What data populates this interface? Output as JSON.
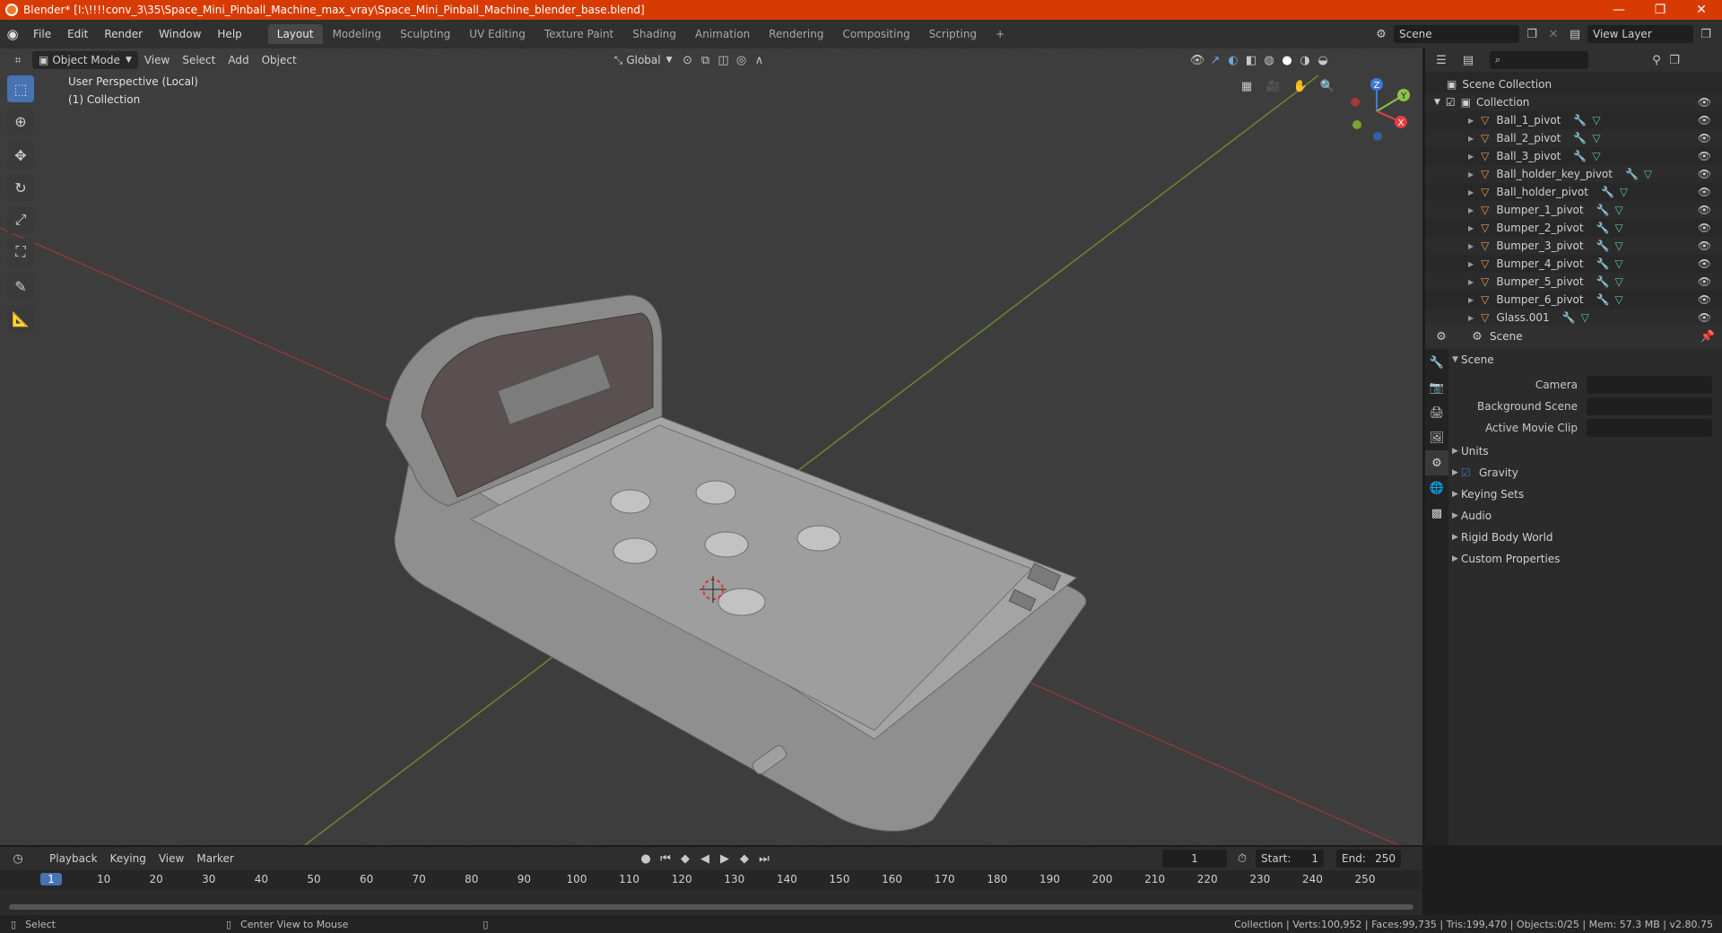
{
  "window": {
    "title": "Blender* [I:\\!!!!conv_3\\35\\Space_Mini_Pinball_Machine_max_vray\\Space_Mini_Pinball_Machine_blender_base.blend]",
    "controls": [
      "—",
      "❐",
      "✕"
    ]
  },
  "menubar": {
    "items": [
      "File",
      "Edit",
      "Render",
      "Window",
      "Help"
    ],
    "workspaces": [
      "Layout",
      "Modeling",
      "Sculpting",
      "UV Editing",
      "Texture Paint",
      "Shading",
      "Animation",
      "Rendering",
      "Compositing",
      "Scripting"
    ],
    "active_workspace": "Layout",
    "add_tab": "+",
    "scene_name": "Scene",
    "view_layer": "View Layer"
  },
  "viewport_header": {
    "mode": "Object Mode",
    "menus": [
      "View",
      "Select",
      "Add",
      "Object"
    ],
    "orientation": "Global"
  },
  "viewport": {
    "info_line1": "User Perspective (Local)",
    "info_line2": "(1) Collection",
    "gizmo_axes": [
      "Z",
      "Y",
      "X"
    ]
  },
  "outliner": {
    "root": "Scene Collection",
    "collection": "Collection",
    "items": [
      "Ball_1_pivot",
      "Ball_2_pivot",
      "Ball_3_pivot",
      "Ball_holder_key_pivot",
      "Ball_holder_pivot",
      "Bumper_1_pivot",
      "Bumper_2_pivot",
      "Bumper_3_pivot",
      "Bumper_4_pivot",
      "Bumper_5_pivot",
      "Bumper_6_pivot",
      "Glass.001"
    ]
  },
  "properties": {
    "header": "Scene",
    "panel_scene": "Scene",
    "fields": [
      {
        "label": "Camera"
      },
      {
        "label": "Background Scene"
      },
      {
        "label": "Active Movie Clip"
      }
    ],
    "collapsed_panels": [
      "Units",
      "Gravity",
      "Keying Sets",
      "Audio",
      "Rigid Body World",
      "Custom Properties"
    ],
    "gravity_checked": true
  },
  "timeline": {
    "menus": [
      "Playback",
      "Keying",
      "View",
      "Marker"
    ],
    "current_frame": "1",
    "start_label": "Start:",
    "start": "1",
    "end_label": "End:",
    "end": "250",
    "ticks": [
      "1",
      "10",
      "20",
      "30",
      "40",
      "50",
      "60",
      "70",
      "80",
      "90",
      "100",
      "110",
      "120",
      "130",
      "140",
      "150",
      "160",
      "170",
      "180",
      "190",
      "200",
      "210",
      "220",
      "230",
      "240",
      "250"
    ]
  },
  "statusbar": {
    "left": "Select",
    "middle": "Center View to Mouse",
    "right": "Collection | Verts:100,952 | Faces:99,735 | Tris:199,470 | Objects:0/25 | Mem: 57.3 MB | v2.80.75"
  }
}
